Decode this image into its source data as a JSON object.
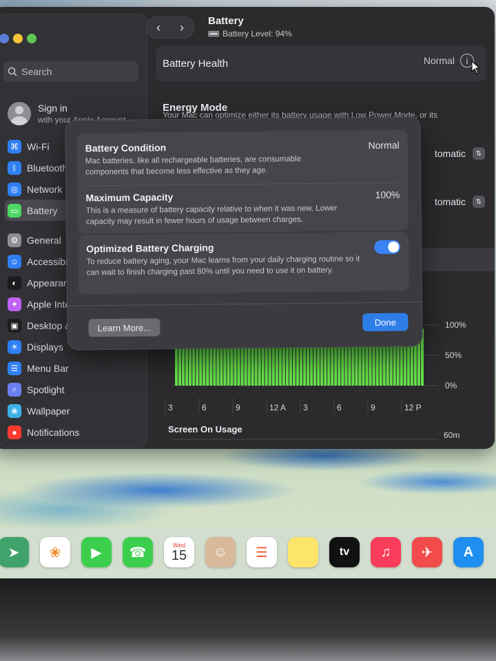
{
  "window": {
    "title": "Battery",
    "subtitle": "Battery Level: 94%"
  },
  "sidebar": {
    "search_placeholder": "Search",
    "account": {
      "title": "Sign in",
      "subtitle": "with your Apple Account"
    },
    "items": [
      {
        "label": "Wi-Fi",
        "icon": "wifi-icon",
        "color": "#2f7ff2"
      },
      {
        "label": "Bluetooth",
        "icon": "bluetooth-icon",
        "color": "#2f7ff2"
      },
      {
        "label": "Network",
        "icon": "network-icon",
        "color": "#2f7ff2"
      },
      {
        "label": "Battery",
        "icon": "battery-icon",
        "color": "#4cd964",
        "active": true
      },
      {
        "label": "General",
        "icon": "gear-icon",
        "color": "#8e8e93"
      },
      {
        "label": "Accessibili",
        "icon": "accessibility-icon",
        "color": "#2f7ff2"
      },
      {
        "label": "Appearanc",
        "icon": "appearance-icon",
        "color": "#1c1c1e"
      },
      {
        "label": "Apple Inte",
        "icon": "apple-intelligence-icon",
        "color": "#c061f5"
      },
      {
        "label": "Desktop &",
        "icon": "desktop-icon",
        "color": "#1c1c1e"
      },
      {
        "label": "Displays",
        "icon": "displays-icon",
        "color": "#2f7ff2"
      },
      {
        "label": "Menu Bar",
        "icon": "menu-bar-icon",
        "color": "#2f7ff2"
      },
      {
        "label": "Spotlight",
        "icon": "spotlight-icon",
        "color": "#6a7ff0"
      },
      {
        "label": "Wallpaper",
        "icon": "wallpaper-icon",
        "color": "#3db0e8"
      },
      {
        "label": "Notifications",
        "icon": "notifications-icon",
        "color": "#ff3b30"
      }
    ]
  },
  "main": {
    "battery_health": {
      "label": "Battery Health",
      "value": "Normal"
    },
    "energy_mode": {
      "title": "Energy Mode",
      "description": "Your Mac can optimize either its battery usage with Low Power Mode, or its"
    },
    "selects": [
      "tomatic",
      "tomatic"
    ],
    "tabs_stub": "s",
    "chart": {
      "y_ticks": [
        "100%",
        "50%",
        "0%"
      ],
      "x_ticks": [
        "3",
        "6",
        "9",
        "12 A",
        "3",
        "6",
        "9",
        "12 P"
      ],
      "screen_on_title": "Screen On Usage",
      "screen_on_tick": "60m"
    }
  },
  "sheet": {
    "battery_condition": {
      "title": "Battery Condition",
      "value": "Normal",
      "description": "Mac batteries, like all rechargeable batteries, are consumable components that become less effective as they age."
    },
    "maximum_capacity": {
      "title": "Maximum Capacity",
      "value": "100%",
      "description": "This is a measure of battery capacity relative to when it was new. Lower capacity may result in fewer hours of usage between charges."
    },
    "optimized_charging": {
      "title": "Optimized Battery Charging",
      "enabled": true,
      "description": "To reduce battery aging, your Mac learns from your daily charging routine so it can wait to finish charging past 80% until you need to use it on battery."
    },
    "learn_more_label": "Learn More...",
    "done_label": "Done"
  },
  "dock": {
    "calendar_month": "Wed",
    "calendar_day": "15",
    "tv_label": "tv",
    "items": [
      {
        "name": "maps-icon",
        "color": "#3fa36b"
      },
      {
        "name": "photos-icon",
        "color": "#ffffff"
      },
      {
        "name": "facetime-icon",
        "color": "#3ccf4e"
      },
      {
        "name": "phone-icon",
        "color": "#3ccf4e"
      },
      {
        "name": "calendar-icon",
        "color": "#ffffff"
      },
      {
        "name": "contacts-icon",
        "color": "#d9b99b"
      },
      {
        "name": "reminders-icon",
        "color": "#ffffff"
      },
      {
        "name": "notes-icon",
        "color": "#fde46a"
      },
      {
        "name": "apple-tv-icon",
        "color": "#111111"
      },
      {
        "name": "music-icon",
        "color": "#fb3c5a"
      },
      {
        "name": "rocket-icon",
        "color": "#f24b4b"
      },
      {
        "name": "app-store-icon",
        "color": "#1f8ef1"
      }
    ]
  },
  "colors": {
    "accent": "#2e7ee8",
    "chart_green": "#66e04a"
  }
}
